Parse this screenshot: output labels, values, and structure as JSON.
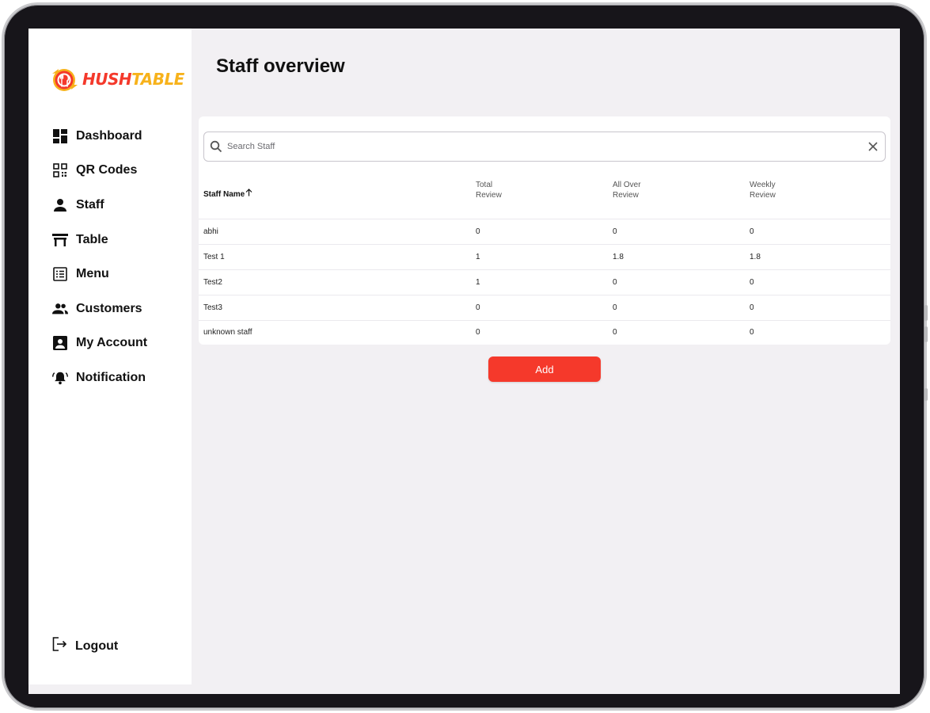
{
  "brand": {
    "name_part1": "HUSH",
    "name_part2": "TABLE",
    "primary": "#f4392b",
    "secondary": "#f7b21b"
  },
  "sidebar": {
    "items": [
      {
        "label": "Dashboard",
        "icon": "dashboard-icon"
      },
      {
        "label": "QR Codes",
        "icon": "qr-code-icon"
      },
      {
        "label": "Staff",
        "icon": "person-icon"
      },
      {
        "label": "Table",
        "icon": "table-icon"
      },
      {
        "label": "Menu",
        "icon": "list-icon"
      },
      {
        "label": "Customers",
        "icon": "people-icon"
      },
      {
        "label": "My Account",
        "icon": "account-box-icon"
      },
      {
        "label": "Notification",
        "icon": "bell-icon"
      }
    ],
    "logout_label": "Logout"
  },
  "page": {
    "title": "Staff overview"
  },
  "search": {
    "placeholder": "Search Staff",
    "value": ""
  },
  "table": {
    "headers": {
      "name": "Staff Name",
      "total_1": "Total",
      "total_2": "Review",
      "allover_1": "All Over",
      "allover_2": "Review",
      "weekly_1": "Weekly",
      "weekly_2": "Review"
    },
    "sort": "ascending",
    "rows": [
      {
        "name": "abhi",
        "total": "0",
        "allover": "0",
        "weekly": "0"
      },
      {
        "name": "Test 1",
        "total": "1",
        "allover": "1.8",
        "weekly": "1.8"
      },
      {
        "name": "Test2",
        "total": "1",
        "allover": "0",
        "weekly": "0"
      },
      {
        "name": "Test3",
        "total": "0",
        "allover": "0",
        "weekly": "0"
      },
      {
        "name": "unknown staff",
        "total": "0",
        "allover": "0",
        "weekly": "0"
      }
    ]
  },
  "actions": {
    "add_label": "Add",
    "add_color": "#f5392b"
  }
}
